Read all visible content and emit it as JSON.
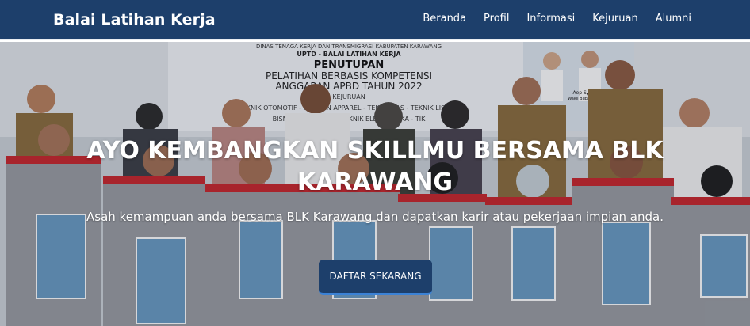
{
  "navbar": {
    "brand": "Balai Latihan Kerja",
    "items": [
      "Beranda",
      "Profil",
      "Informasi",
      "Kejuruan",
      "Alumni"
    ]
  },
  "hero": {
    "title": "AYO KEMBANGKAN SKILLMU BERSAMA BLK KARAWANG",
    "subtitle": "Asah kemampuan anda bersama BLK Karawang dan dapatkan karir atau pekerjaan impian anda.",
    "cta_label": "DAFTAR SEKARANG",
    "banner": {
      "line1": "DINAS TENAGA KERJA DAN TRANSMIGRASI KABUPATEN KARAWANG",
      "line2": "UPTD - BALAI LATIHAN KERJA",
      "line3": "PENUTUPAN",
      "line4": "PELATIHAN BERBASIS KOMPETENSI",
      "line5": "ANGGARAN APBD TAHUN 2022",
      "line6": "KEJURUAN",
      "line7": "TEKNIK OTOMOTIF - GARMEN APPAREL - TEKNIK LAS - TEKNIK LISTRIK",
      "line8": "BISNIS MANAJEMEN - TEKNIK ELEKTRONIKA - TIK",
      "name1": "Aep Syaepuloh",
      "name2": "Wakil Bupati Karawang"
    }
  },
  "colors": {
    "navbar": "#1d3f6b",
    "cta": "#1d3f6b",
    "cta_accent": "#3b82d6",
    "uniform_red": "#c8262c",
    "uniform_grey": "#9a9da3",
    "folder_blue": "#6a9bc4",
    "officer_khaki": "#8b6d3d"
  }
}
